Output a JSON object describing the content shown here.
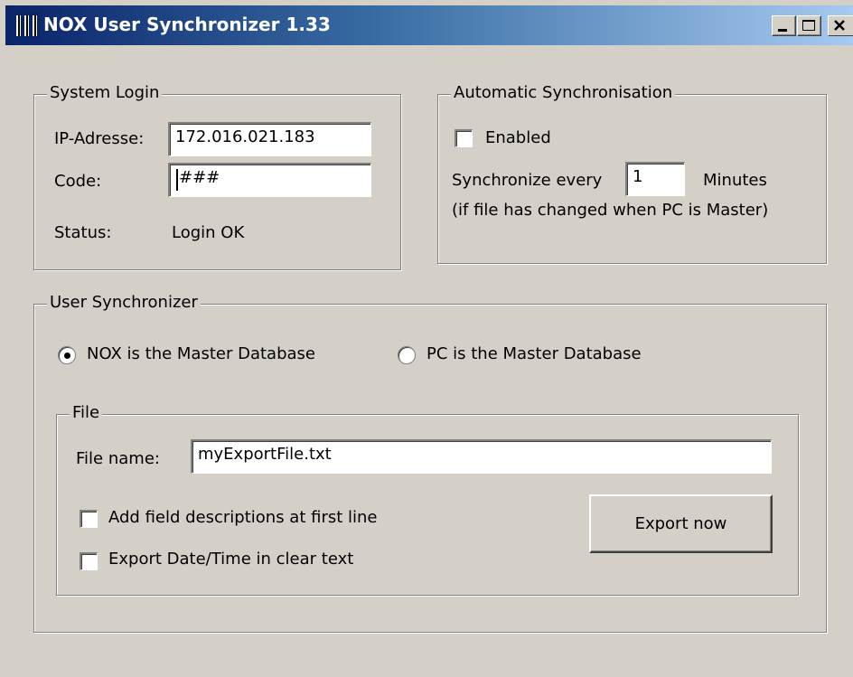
{
  "window": {
    "title": "NOX User Synchronizer 1.33",
    "app_icon": "nox-app-icon",
    "controls": [
      "minimize-icon",
      "maximize-icon",
      "close-icon"
    ],
    "title_gradient": [
      "#0a246a",
      "#a6caf0"
    ],
    "face_color": "#d4d0c8"
  },
  "system_login": {
    "legend": "System Login",
    "ip_label": "IP-Adresse:",
    "ip_value": "172.016.021.183",
    "code_label": "Code:",
    "code_value": "###",
    "status_label": "Status:",
    "status_value": "Login OK"
  },
  "auto_sync": {
    "legend": "Automatic Synchronisation",
    "enabled_label": "Enabled",
    "enabled_checked": false,
    "every_label": "Synchronize every",
    "every_value": "1",
    "unit_label": "Minutes",
    "note": "(if file has changed when PC is Master)"
  },
  "user_sync": {
    "legend": "User Synchronizer",
    "options": [
      {
        "label": "NOX is the Master Database",
        "selected": true
      },
      {
        "label": "PC is the Master Database",
        "selected": false
      }
    ],
    "file": {
      "legend": "File",
      "filename_label": "File name:",
      "filename_value": "myExportFile.txt",
      "checkboxes": [
        {
          "label": "Add field descriptions at first line",
          "checked": false
        },
        {
          "label": "Export Date/Time in clear text",
          "checked": false
        }
      ],
      "export_button": "Export now"
    }
  }
}
